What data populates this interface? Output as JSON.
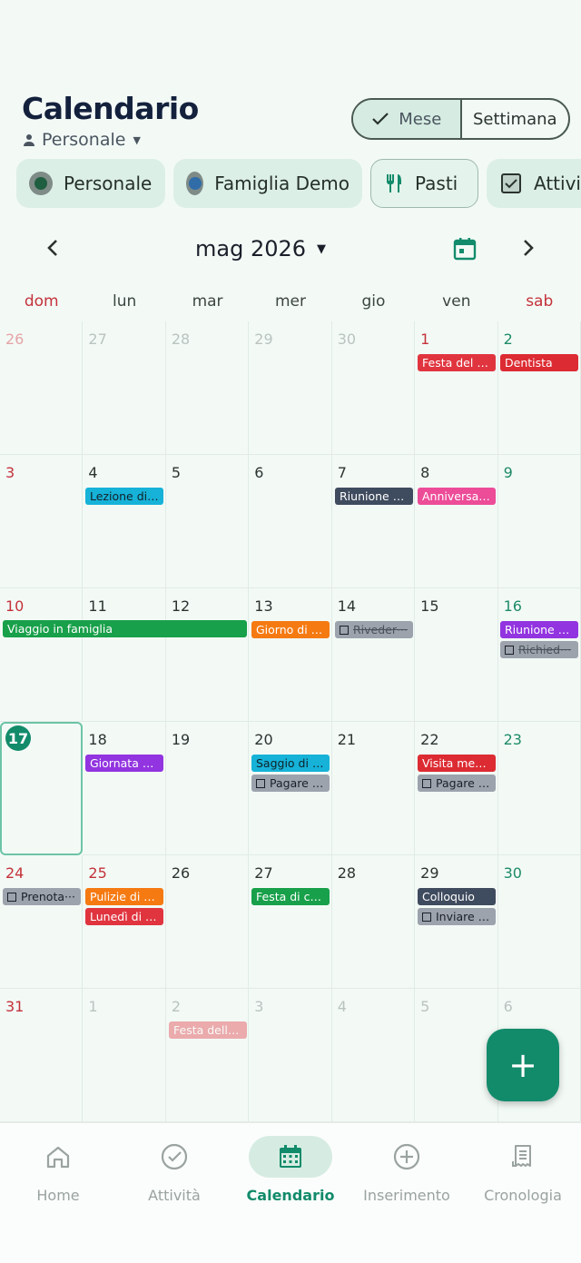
{
  "header": {
    "title": "Calendario",
    "profile": "Personale",
    "views": {
      "month": "Mese",
      "week": "Settimana"
    }
  },
  "chips": [
    "Personale",
    "Famiglia Demo",
    "Pasti",
    "Attivit"
  ],
  "nav": {
    "month_label": "mag 2026"
  },
  "weekdays": [
    "dom",
    "lun",
    "mar",
    "mer",
    "gio",
    "ven",
    "sab"
  ],
  "days": [
    "26",
    "27",
    "28",
    "29",
    "30",
    "1",
    "2",
    "3",
    "4",
    "5",
    "6",
    "7",
    "8",
    "9",
    "10",
    "11",
    "12",
    "13",
    "14",
    "15",
    "16",
    "17",
    "18",
    "19",
    "20",
    "21",
    "22",
    "23",
    "24",
    "25",
    "26",
    "27",
    "28",
    "29",
    "30",
    "31",
    "1",
    "2",
    "3",
    "4",
    "5",
    "6"
  ],
  "events": {
    "e1": "Festa del L···",
    "e2": "Dentista",
    "e3": "Lezione di i···",
    "e4": "Riunione d···",
    "e5": "Anniversari···",
    "e6": "Viaggio in famiglia",
    "e7": "Giorno di p···",
    "e8": "Riveder···",
    "e9": "Riunione g···",
    "e10": "Richied···",
    "e11": "Giornata s···",
    "e12": "Saggio di p···",
    "e13": "Pagare l···",
    "e14": "Visita medica",
    "e15": "Pagare a···",
    "e16": "Prenota···",
    "e17": "Pulizie di p···",
    "e18": "Lunedì di P···",
    "e19": "Festa di co···",
    "e20": "Colloquio",
    "e21": "Inviare l···",
    "e22": "Festa della ···"
  },
  "fab": "+",
  "tabs": {
    "home": "Home",
    "tasks": "Attività",
    "calendar": "Calendario",
    "insert": "Inserimento",
    "history": "Cronologia"
  },
  "colors": {
    "accent": "#128b6b",
    "red": "#e0353f",
    "cyan": "#16b2d8",
    "slate": "#3f4b5e",
    "pink": "#ec4c98",
    "green": "#18a04a",
    "orange": "#f57a12",
    "purple": "#9234e0",
    "gray": "#9ca3ad"
  }
}
